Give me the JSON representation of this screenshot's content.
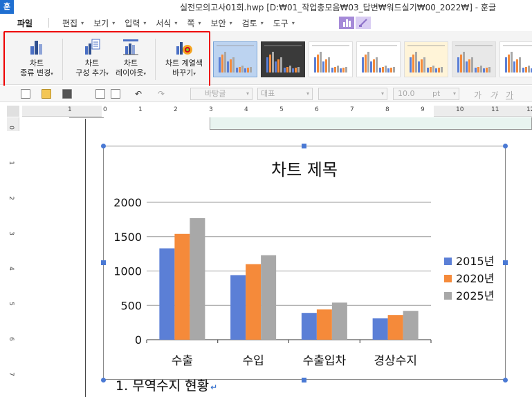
{
  "window": {
    "app_logo": "훈",
    "title": "실전모의고사01회.hwp [D:₩01_작업총모음₩03_답변₩워드실기₩00_2022₩] - 훈글"
  },
  "menu": {
    "file": "파일",
    "items": [
      {
        "label": "편집"
      },
      {
        "label": "보기"
      },
      {
        "label": "입력"
      },
      {
        "label": "서식"
      },
      {
        "label": "쪽"
      },
      {
        "label": "보안"
      },
      {
        "label": "검토"
      },
      {
        "label": "도구"
      }
    ]
  },
  "ribbon": {
    "buttons": [
      {
        "line1": "차트",
        "line2": "종류 변경",
        "icon": "chart-type-icon"
      },
      {
        "line1": "차트",
        "line2": "구성 추가",
        "icon": "chart-elements-icon"
      },
      {
        "line1": "차트",
        "line2": "레이아웃",
        "icon": "chart-layout-icon"
      },
      {
        "line1": "차트 계열색",
        "line2": "바꾸기",
        "icon": "chart-color-icon"
      }
    ],
    "styles": [
      {
        "variant": "sel"
      },
      {
        "variant": "dark"
      },
      {
        "variant": "plain"
      },
      {
        "variant": "plain"
      },
      {
        "variant": "warm"
      },
      {
        "variant": "grey"
      },
      {
        "variant": "plain"
      }
    ],
    "colors": {
      "blue": "#5b7fd6",
      "orange": "#f58a3a",
      "gray": "#a8a8a8"
    }
  },
  "toolbar": {
    "style_value": "바탕글",
    "font_lang": "대표",
    "font_size": "10.0",
    "unit": "pt"
  },
  "ruler": {
    "h_numbers": [
      "1",
      "0",
      "1",
      "2",
      "3",
      "4",
      "5",
      "6",
      "7",
      "8",
      "9",
      "10",
      "11",
      "12"
    ],
    "v_numbers": [
      "0",
      "1",
      "2",
      "3",
      "4",
      "5",
      "6",
      "7"
    ]
  },
  "chart_data": {
    "type": "bar",
    "title": "차트 제목",
    "categories": [
      "수출",
      "수입",
      "수출입차",
      "경상수지"
    ],
    "series": [
      {
        "name": "2015년",
        "values": [
          1330,
          940,
          390,
          310
        ],
        "color": "#5b7fd6"
      },
      {
        "name": "2020년",
        "values": [
          1540,
          1100,
          440,
          360
        ],
        "color": "#f58a3a"
      },
      {
        "name": "2025년",
        "values": [
          1770,
          1230,
          540,
          420
        ],
        "color": "#a8a8a8"
      }
    ],
    "ylim": [
      0,
      2000
    ],
    "yticks": [
      0,
      500,
      1000,
      1500,
      2000
    ],
    "grid": true,
    "legend": "right"
  },
  "document": {
    "heading_number": "1.",
    "heading_text": "무역수지 현황",
    "return_mark": "↵"
  }
}
